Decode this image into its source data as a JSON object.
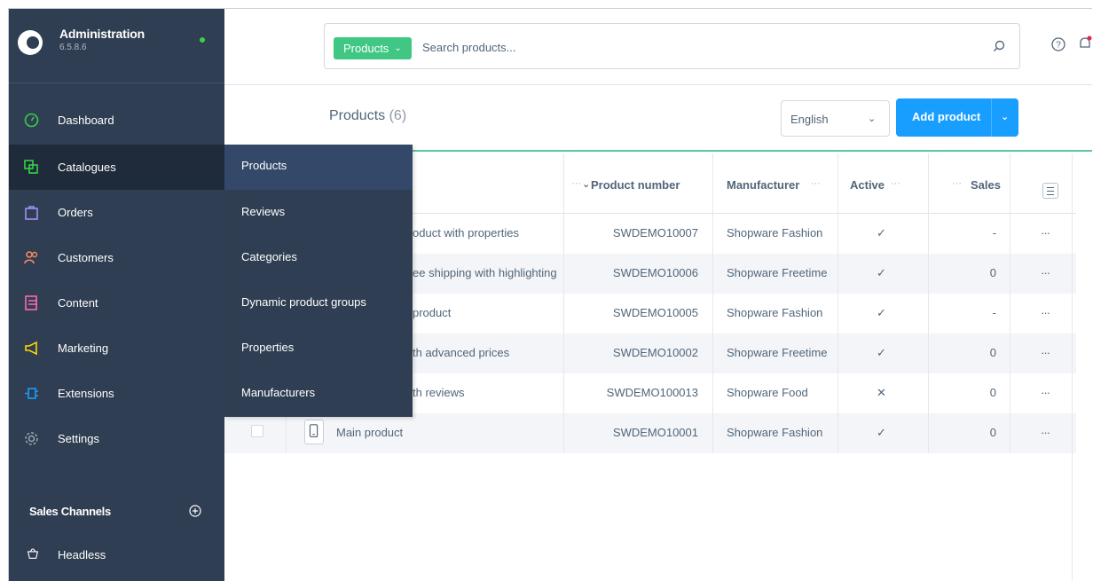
{
  "app": {
    "title": "Administration",
    "version": "6.5.8.6",
    "status_color": "#37d046"
  },
  "sidebar": {
    "items": [
      {
        "label": "Dashboard",
        "icon": "gauge-icon",
        "color": "#37d046"
      },
      {
        "label": "Catalogues",
        "icon": "catalogue-icon",
        "color": "#37d046",
        "active": true
      },
      {
        "label": "Orders",
        "icon": "bag-icon",
        "color": "#a092f0"
      },
      {
        "label": "Customers",
        "icon": "users-icon",
        "color": "#f88962"
      },
      {
        "label": "Content",
        "icon": "content-icon",
        "color": "#ff68b4"
      },
      {
        "label": "Marketing",
        "icon": "megaphone-icon",
        "color": "#ffd700"
      },
      {
        "label": "Extensions",
        "icon": "plug-icon",
        "color": "#189eff"
      },
      {
        "label": "Settings",
        "icon": "gear-icon",
        "color": "#9aa8b5"
      }
    ],
    "sales_channels_title": "Sales Channels",
    "sales_channels": [
      {
        "label": "Headless",
        "icon": "basket-icon"
      }
    ]
  },
  "flyout": {
    "items": [
      "Products",
      "Reviews",
      "Categories",
      "Dynamic product groups",
      "Properties",
      "Manufacturers"
    ]
  },
  "search": {
    "type_label": "Products",
    "placeholder": "Search products..."
  },
  "smartbar": {
    "title": "Products",
    "count": "(6)",
    "language": "English",
    "add_label": "Add product"
  },
  "table": {
    "columns": {
      "product_number": "Product number",
      "manufacturer": "Manufacturer",
      "active": "Active",
      "sales": "Sales"
    },
    "rows": [
      {
        "name": "oduct with properties",
        "number": "SWDEMO10007",
        "manufacturer": "Shopware Fashion",
        "active": "✓",
        "sales": "-"
      },
      {
        "name": "ee shipping with highlighting",
        "number": "SWDEMO10006",
        "manufacturer": "Shopware Freetime",
        "active": "✓",
        "sales": "0"
      },
      {
        "name": "product",
        "number": "SWDEMO10005",
        "manufacturer": "Shopware Fashion",
        "active": "✓",
        "sales": "-"
      },
      {
        "name": "th advanced prices",
        "number": "SWDEMO10002",
        "manufacturer": "Shopware Freetime",
        "active": "✓",
        "sales": "0"
      },
      {
        "name": "th reviews",
        "number": "SWDEMO100013",
        "manufacturer": "Shopware Food",
        "active": "✕",
        "sales": "0"
      },
      {
        "name": "Main product",
        "number": "SWDEMO10001",
        "manufacturer": "Shopware Fashion",
        "active": "✓",
        "sales": "0"
      }
    ],
    "actions_label": "···"
  }
}
